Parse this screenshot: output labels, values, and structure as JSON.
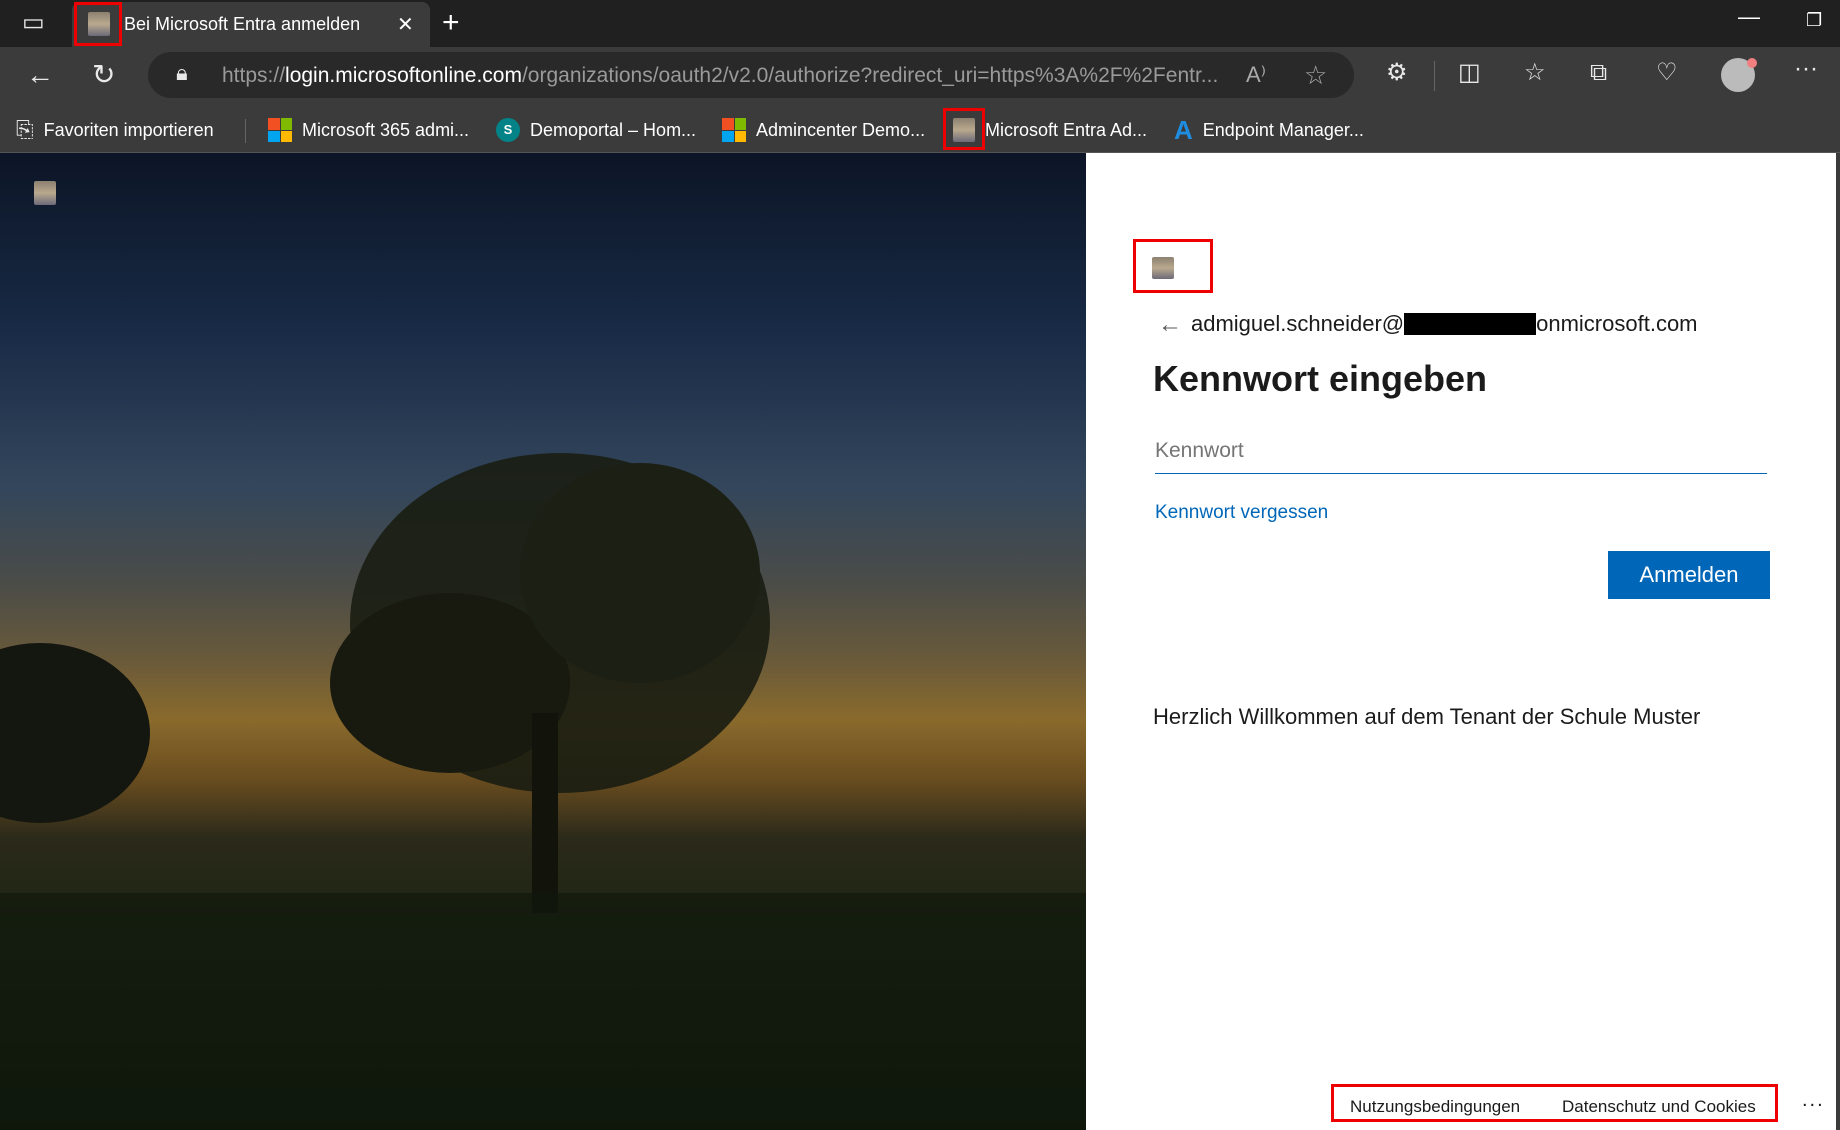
{
  "browser": {
    "tab_title": "Bei Microsoft Entra anmelden",
    "url_prefix": "https://",
    "url_host": "login.microsoftonline.com",
    "url_path": "/organizations/oauth2/v2.0/authorize?redirect_uri=https%3A%2F%2Fentr...",
    "bookmarks": [
      {
        "label": "Favoriten importieren"
      },
      {
        "label": "Microsoft 365 admi..."
      },
      {
        "label": "Demoportal – Hom..."
      },
      {
        "label": "Admincenter Demo..."
      },
      {
        "label": "Microsoft Entra Ad..."
      },
      {
        "label": "Endpoint Manager..."
      }
    ]
  },
  "login": {
    "account": "admiguel.schneider@",
    "account_suffix": "onmicrosoft.com",
    "title": "Kennwort eingeben",
    "password_placeholder": "Kennwort",
    "forgot_link": "Kennwort vergessen",
    "submit": "Anmelden",
    "welcome": "Herzlich Willkommen auf dem Tenant der Schule Muster",
    "footer": {
      "terms": "Nutzungsbedingungen",
      "privacy": "Datenschutz und Cookies",
      "more": "..."
    }
  },
  "colors": {
    "accent": "#0067b8",
    "highlight": "#e00000"
  }
}
